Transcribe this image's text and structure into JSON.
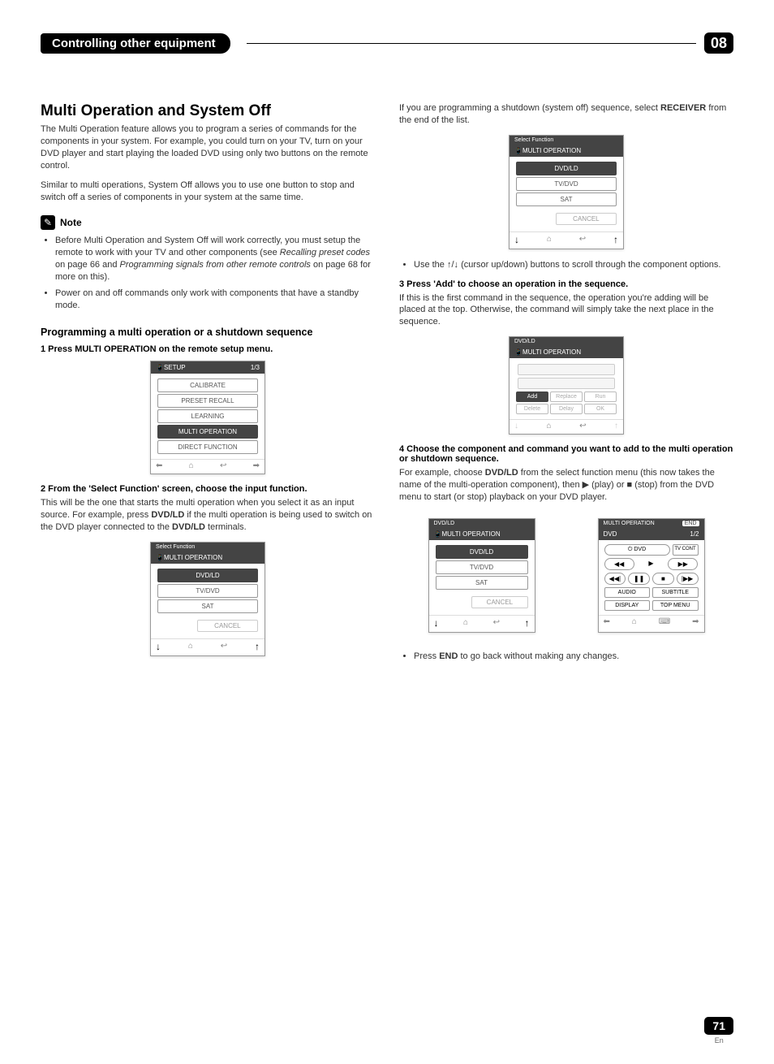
{
  "header": {
    "title": "Controlling other equipment",
    "chapter": "08"
  },
  "left": {
    "h1": "Multi Operation and System Off",
    "p1": "The Multi Operation feature allows you to program a series of commands for the components in your system. For example, you could turn on your TV, turn on your DVD player and start playing the loaded DVD using only two buttons on the remote control.",
    "p2": "Similar to multi operations, System Off allows you to use one button to stop and switch off a series of components in your system at the same time.",
    "note_label": "Note",
    "note1a": "Before Multi Operation and System Off will work correctly, you must setup the remote to work with your TV and other components (see ",
    "note1b": "Recalling preset codes",
    "note1c": " on page 66 and ",
    "note1d": "Programming signals from other remote controls",
    "note1e": " on page 68 for more on this).",
    "note2": "Power on and off commands only work with components that have a standby mode.",
    "subhead": "Programming a multi operation or a shutdown sequence",
    "step1": "1    Press MULTI OPERATION on the remote setup menu.",
    "setup_title": "SETUP",
    "setup_page": "1/3",
    "setup_items": [
      "CALIBRATE",
      "PRESET RECALL",
      "LEARNING",
      "MULTI OPERATION",
      "DIRECT FUNCTION"
    ],
    "step2": "2    From the 'Select Function' screen, choose the input function.",
    "p3a": "This will be the one that starts the multi operation when you select it as an input source. For example, press ",
    "p3b": "DVD/LD",
    "p3c": " if the multi operation is being used to switch on the DVD player connected to the ",
    "p3d": "DVD/LD",
    "p3e": " terminals.",
    "sf_title": "MULTI OPERATION",
    "sf_sub": "Select Function",
    "sf_items": [
      "DVD/LD",
      "TV/DVD",
      "SAT"
    ],
    "cancel": "CANCEL"
  },
  "right": {
    "p1a": "If you are programming a shutdown (system off) sequence, select ",
    "p1b": "RECEIVER",
    "p1c": " from the end of the list.",
    "sf_title": "MULTI OPERATION",
    "sf_sub": "Select Function",
    "sf_items": [
      "DVD/LD",
      "TV/DVD",
      "SAT"
    ],
    "cancel": "CANCEL",
    "bullet1": "Use the ↑/↓ (cursor up/down) buttons to scroll through the component options.",
    "step3": "3    Press 'Add' to choose an operation in the sequence.",
    "p2": "If this is the first command in the sequence, the operation you're adding will be placed at the top. Otherwise, the command will simply take the next place in the sequence.",
    "mo_sub": "DVD/LD",
    "mo_title": "MULTI OPERATION",
    "mo_row1": [
      "Add",
      "Replace",
      "Run"
    ],
    "mo_row2": [
      "Delete",
      "Delay",
      "OK"
    ],
    "step4": "4    Choose the component and command you want to add to the multi operation or shutdown sequence.",
    "p3a": "For example, choose ",
    "p3b": "DVD/LD",
    "p3c": " from the select function menu (this now takes the name of the multi-operation component), then ▶ (play) or ■ (stop) from the DVD menu to start (or stop) playback on your DVD player.",
    "dvdA_sub": "DVD/LD",
    "dvdA_title": "MULTI OPERATION",
    "dvdA_items": [
      "DVD/LD",
      "TV/DVD",
      "SAT"
    ],
    "dvdB_topleft": "MULTI OPERATION",
    "dvdB_end": "END",
    "dvdB_title": "DVD",
    "dvdB_page": "1/2",
    "dvdB_power": "DVD",
    "dvdB_tvcont": "TV CONT",
    "dvdB_audio": "AUDIO",
    "dvdB_subtitle": "SUBTITLE",
    "dvdB_display": "DISPLAY",
    "dvdB_topmenu": "TOP MENU",
    "bullet2a": "Press ",
    "bullet2b": "END",
    "bullet2c": " to go back without making any changes."
  },
  "footer": {
    "page": "71",
    "lang": "En"
  }
}
